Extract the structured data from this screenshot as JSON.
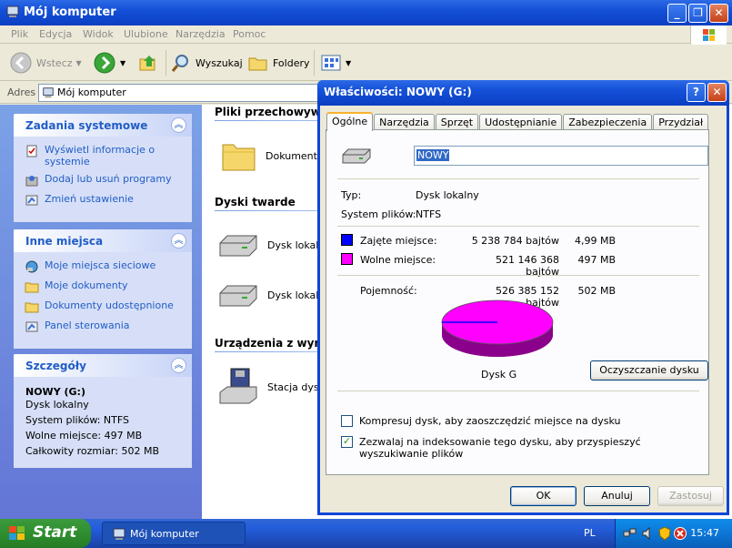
{
  "explorer": {
    "title": "Mój komputer",
    "menu": [
      "Plik",
      "Edycja",
      "Widok",
      "Ulubione",
      "Narzędzia",
      "Pomoc"
    ],
    "toolbar": {
      "back": "Wstecz",
      "search": "Wyszukaj",
      "folders": "Foldery"
    },
    "address": {
      "label": "Adres",
      "value": "Mój komputer"
    },
    "left": {
      "tasks": {
        "title": "Zadania systemowe",
        "items": [
          "Wyświetl informacje o systemie",
          "Dodaj lub usuń programy",
          "Zmień ustawienie"
        ]
      },
      "places": {
        "title": "Inne miejsca",
        "items": [
          "Moje miejsca sieciowe",
          "Moje dokumenty",
          "Dokumenty udostępnione",
          "Panel sterowania"
        ]
      },
      "details": {
        "title": "Szczegóły",
        "name": "NOWY (G:)",
        "type": "Dysk lokalny",
        "fs": "System plików: NTFS",
        "free": "Wolne miejsce: 497 MB",
        "total": "Całkowity rozmiar: 502 MB"
      }
    },
    "content": {
      "stored": {
        "title": "Pliki przechowywane",
        "items": [
          "Dokumenty"
        ]
      },
      "hdd": {
        "title": "Dyski twarde",
        "items": [
          "Dysk lokalny",
          "Dysk lokalny"
        ]
      },
      "removable": {
        "title": "Urządzenia z wymie",
        "items": [
          "Stacja dyski"
        ]
      }
    }
  },
  "dialog": {
    "title": "Właściwości: NOWY (G:)",
    "tabs": [
      "Ogólne",
      "Narzędzia",
      "Sprzęt",
      "Udostępnianie",
      "Zabezpieczenia",
      "Przydział"
    ],
    "name_value": "NOWY",
    "type_label": "Typ:",
    "type_value": "Dysk lokalny",
    "fs_label": "System plików:",
    "fs_value": "NTFS",
    "used": {
      "label": "Zajęte miejsce:",
      "bytes": "5 238 784 bajtów",
      "size": "4,99 MB",
      "color": "#0000FF"
    },
    "free": {
      "label": "Wolne miejsce:",
      "bytes": "521 146 368 bajtów",
      "size": "497 MB",
      "color": "#FF00FF"
    },
    "capacity": {
      "label": "Pojemność:",
      "bytes": "526 385 152 bajtów",
      "size": "502 MB"
    },
    "disk_label": "Dysk G",
    "cleanup": "Oczyszczanie dysku",
    "compress": "Kompresuj dysk, aby zaoszczędzić miejsce na dysku",
    "index": "Zezwalaj na indeksowanie tego dysku, aby przyspieszyć wyszukiwanie plików",
    "ok": "OK",
    "cancel": "Anuluj",
    "apply": "Zastosuj"
  },
  "taskbar": {
    "start": "Start",
    "task": "Mój komputer",
    "lang": "PL",
    "clock": "15:47"
  }
}
